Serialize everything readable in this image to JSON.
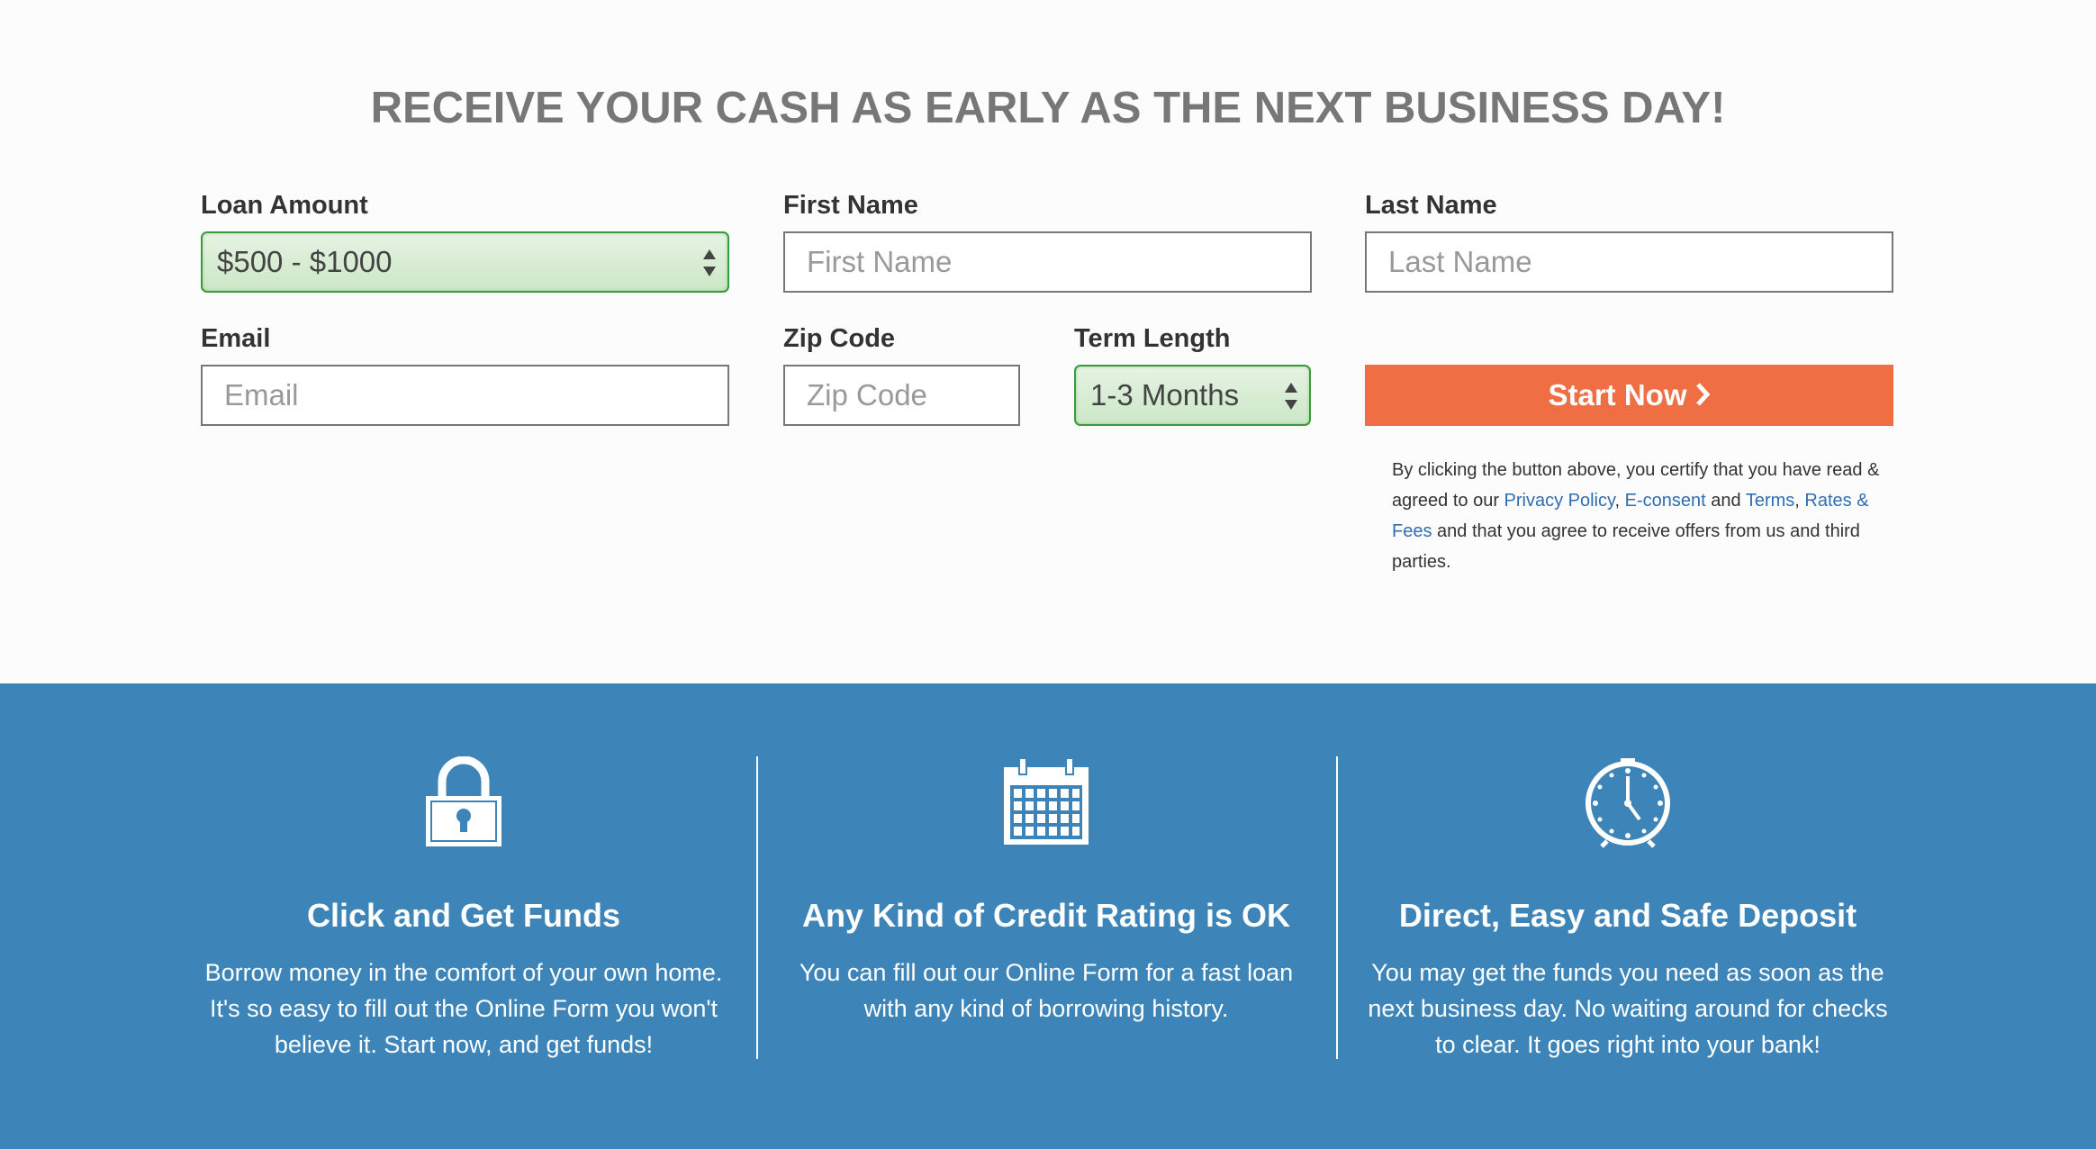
{
  "headline": "RECEIVE YOUR CASH AS EARLY AS THE NEXT BUSINESS DAY!",
  "form": {
    "loan_amount_label": "Loan Amount",
    "loan_amount_value": "$500 - $1000",
    "first_name_label": "First Name",
    "first_name_placeholder": "First Name",
    "last_name_label": "Last Name",
    "last_name_placeholder": "Last Name",
    "email_label": "Email",
    "email_placeholder": "Email",
    "zip_label": "Zip Code",
    "zip_placeholder": "Zip Code",
    "term_label": "Term Length",
    "term_value": "1-3 Months",
    "start_button": "Start Now"
  },
  "disclaimer": {
    "part1": "By clicking the button above, you certify that you have read & agreed to our ",
    "privacy_link": "Privacy Policy",
    "comma1": ", ",
    "econsent_link": "E-consent",
    "and1": " and ",
    "terms_link": "Terms",
    "comma2": ", ",
    "rates_link": "Rates & Fees",
    "part2": " and that you agree to receive offers from us and third parties."
  },
  "features": [
    {
      "icon": "lock-icon",
      "title": "Click and Get Funds",
      "text": "Borrow money in the comfort of your own home. It's so easy to fill out the Online Form you won't believe it. Start now, and get funds!"
    },
    {
      "icon": "calendar-icon",
      "title": "Any Kind of Credit Rating is OK",
      "text": "You can fill out our Online Form for a fast loan with any kind of borrowing history."
    },
    {
      "icon": "clock-icon",
      "title": "Direct, Easy and Safe Deposit",
      "text": "You may get the funds you need as soon as the next business day. No waiting around for checks to clear. It goes right into your bank!"
    }
  ],
  "colors": {
    "accent_orange": "#ef6e43",
    "band_blue": "#3d85b8",
    "link_blue": "#2f6db3",
    "select_green": "#3c9a3c"
  }
}
